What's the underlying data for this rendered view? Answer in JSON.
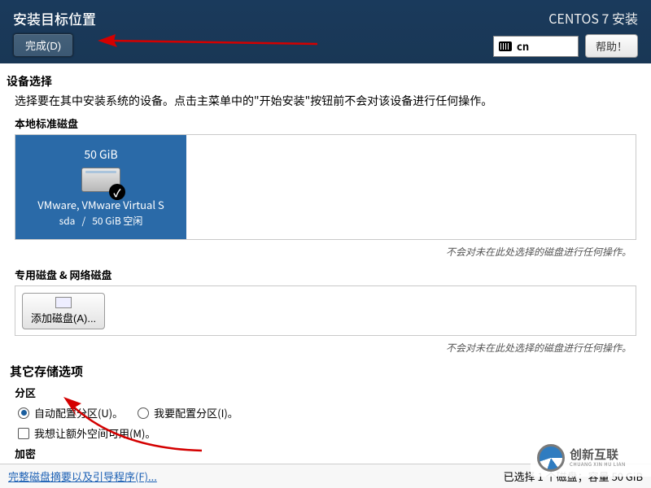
{
  "header": {
    "title": "安装目标位置",
    "done": "完成(D)",
    "installer": "CENTOS 7 安装",
    "lang": "cn",
    "help": "帮助！"
  },
  "device": {
    "heading": "设备选择",
    "desc": "选择要在其中安装系统的设备。点击主菜单中的\"开始安装\"按钮前不会对该设备进行任何操作。",
    "local_heading": "本地标准磁盘",
    "disk": {
      "size": "50 GiB",
      "name": "VMware, VMware Virtual S",
      "id": "sda",
      "sep": "/",
      "free": "50 GiB 空闲"
    },
    "note": "不会对未在此处选择的磁盘进行任何操作。",
    "net_heading": "专用磁盘 & 网络磁盘",
    "add_disk": "添加磁盘(A)..."
  },
  "other": {
    "heading": "其它存储选项",
    "part_heading": "分区",
    "auto": "自动配置分区(U)。",
    "manual": "我要配置分区(I)。",
    "extra_space": "我想让额外空间可用(M)。",
    "enc_heading": "加密"
  },
  "bottom": {
    "link": "完整磁盘摘要以及引导程序(F)...",
    "status": "已选择 1 个磁盘；容量 50 GiB"
  },
  "watermark": {
    "name": "创新互联",
    "sub": "CHUANG XIN HU LIAN"
  }
}
